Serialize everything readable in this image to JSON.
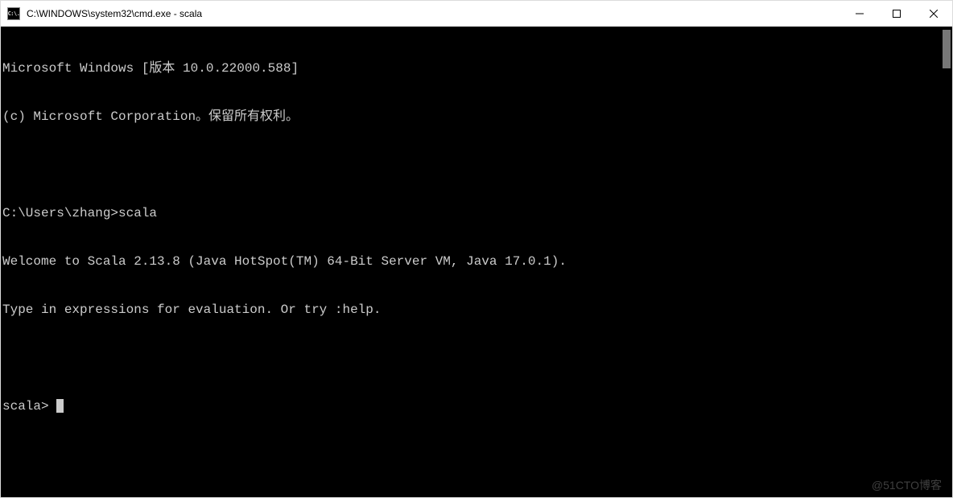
{
  "window": {
    "title": "C:\\WINDOWS\\system32\\cmd.exe - scala",
    "icon_label": "C:\\."
  },
  "terminal": {
    "lines": [
      "Microsoft Windows [版本 10.0.22000.588]",
      "(c) Microsoft Corporation。保留所有权利。",
      "",
      "C:\\Users\\zhang>scala",
      "Welcome to Scala 2.13.8 (Java HotSpot(TM) 64-Bit Server VM, Java 17.0.1).",
      "Type in expressions for evaluation. Or try :help.",
      ""
    ],
    "prompt": "scala> "
  },
  "watermark": "@51CTO博客"
}
